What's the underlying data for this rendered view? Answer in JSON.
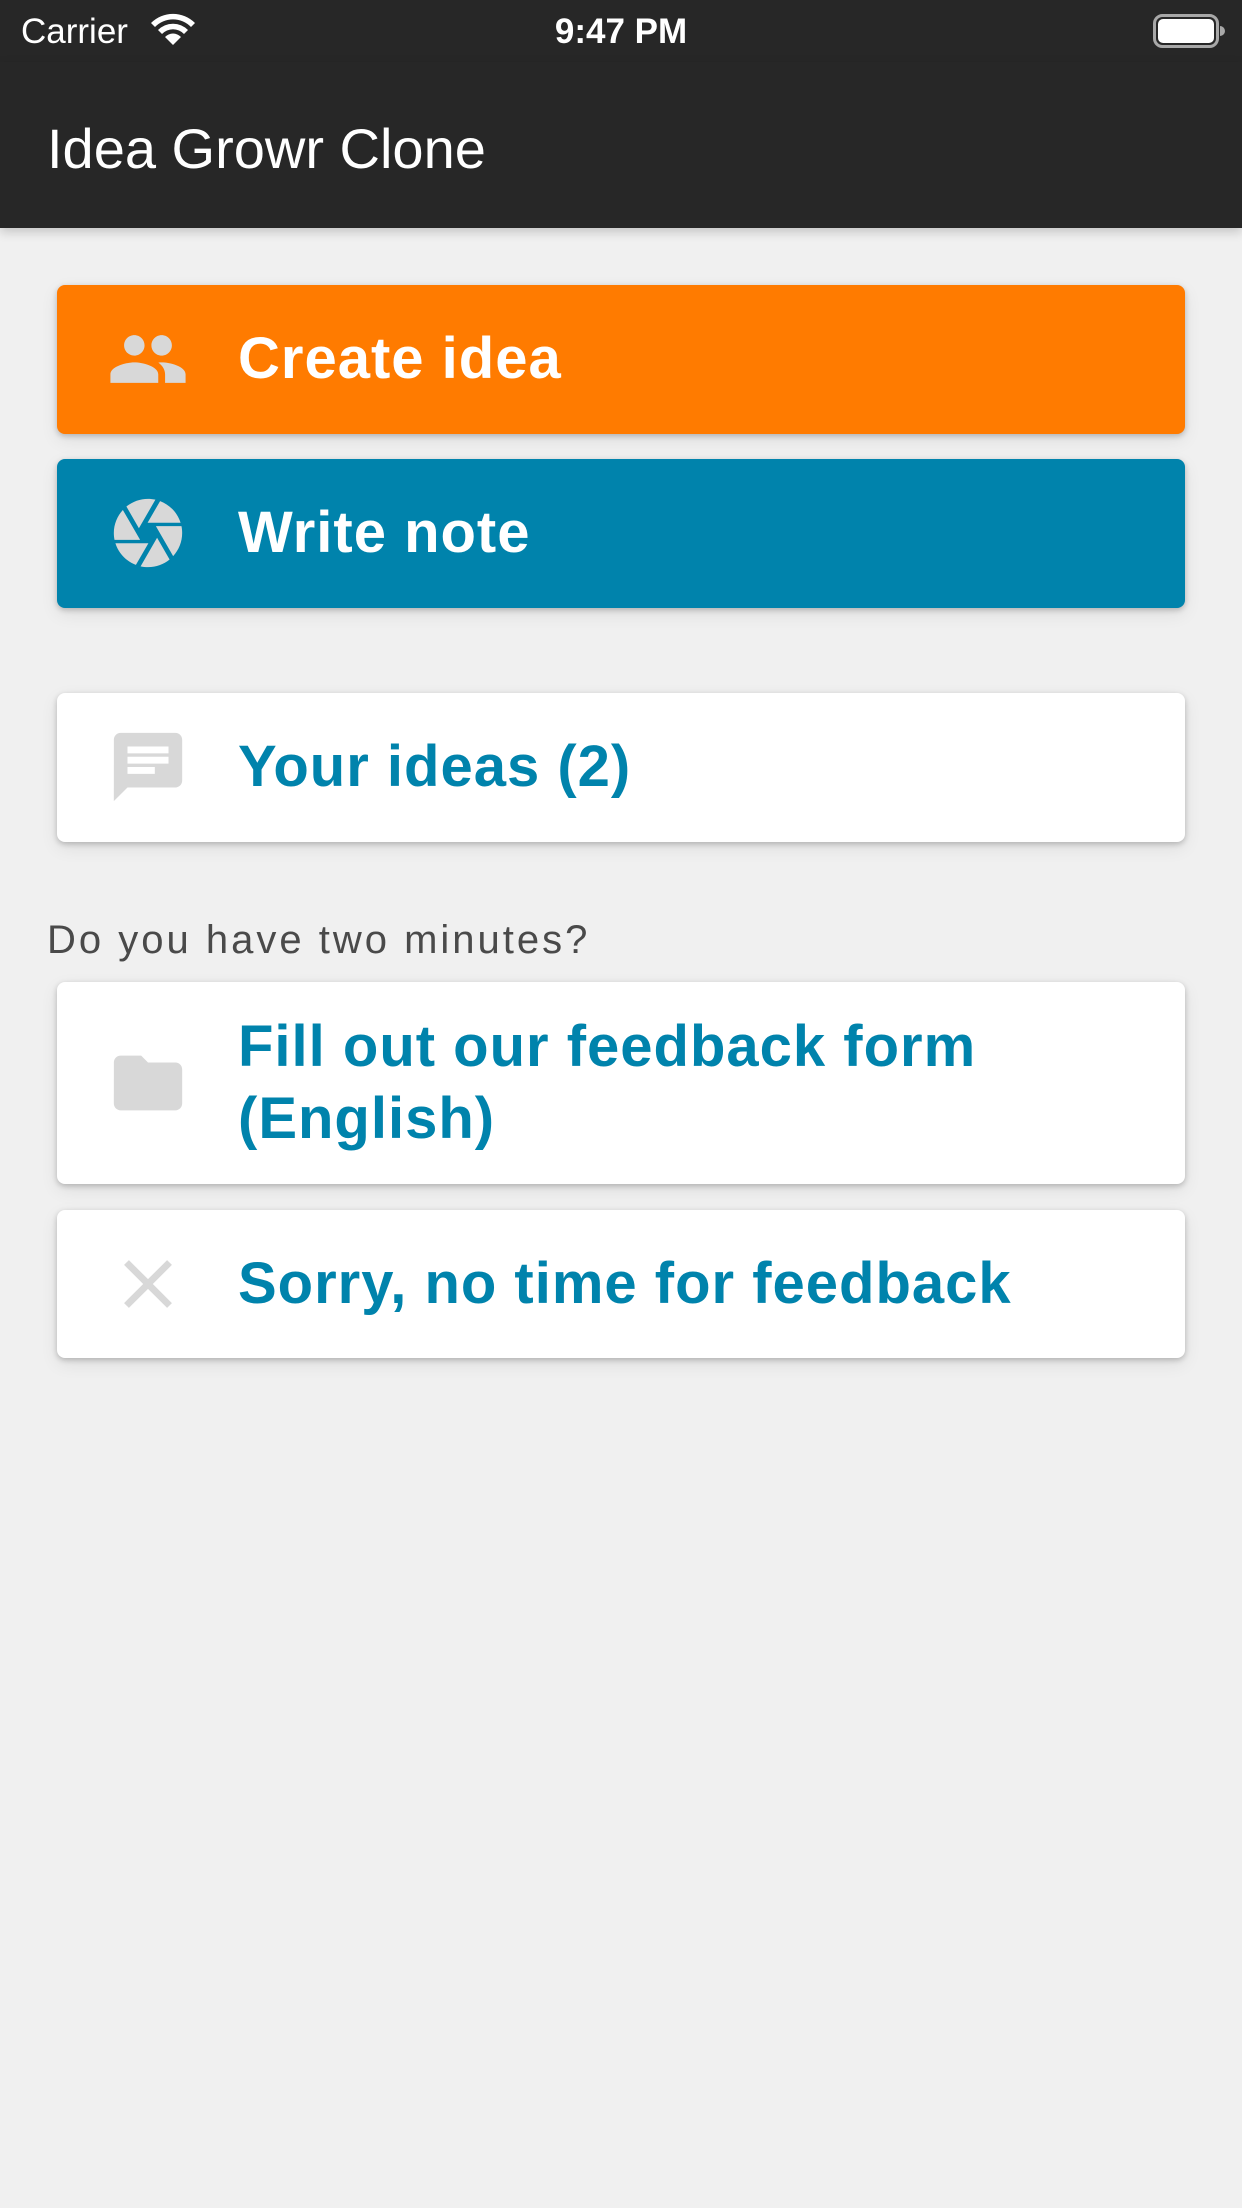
{
  "status_bar": {
    "carrier": "Carrier",
    "time": "9:47 PM",
    "wifi_icon": "wifi-icon",
    "battery_icon": "battery-icon"
  },
  "app_bar": {
    "title": "Idea Growr Clone"
  },
  "actions": {
    "create_idea": {
      "label": "Create idea",
      "icon": "people-icon",
      "color": "#ff7b00"
    },
    "write_note": {
      "label": "Write note",
      "icon": "camera-shutter-icon",
      "color": "#0083ac"
    },
    "your_ideas": {
      "label": "Your ideas (2)",
      "icon": "chat-message-icon"
    }
  },
  "feedback": {
    "heading": "Do you have two minutes?",
    "fill_form": {
      "label": "Fill out our feedback form (English)",
      "icon": "folder-icon"
    },
    "no_time": {
      "label": "Sorry, no time for feedback",
      "icon": "close-icon"
    }
  },
  "colors": {
    "app_bar": "#272727",
    "background": "#f0f0f0",
    "accent_blue": "#0083ac",
    "accent_orange": "#ff7b00",
    "icon_gray": "#d8d8d8"
  }
}
